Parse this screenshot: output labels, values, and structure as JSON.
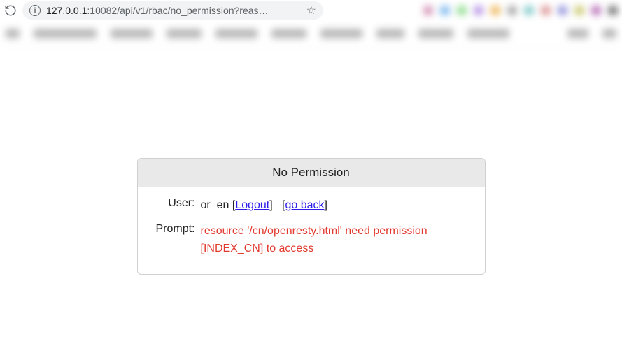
{
  "browser": {
    "url_host": "127.0.0.1",
    "url_rest": ":10082/api/v1/rbac/no_permission?reas…"
  },
  "panel": {
    "title": "No Permission",
    "user_label": "User:",
    "prompt_label": "Prompt:",
    "user_value": "or_en",
    "logout_link": "Logout",
    "goback_link": "go back",
    "prompt_msg": "resource '/cn/openresty.html' need permission [INDEX_CN] to access"
  }
}
